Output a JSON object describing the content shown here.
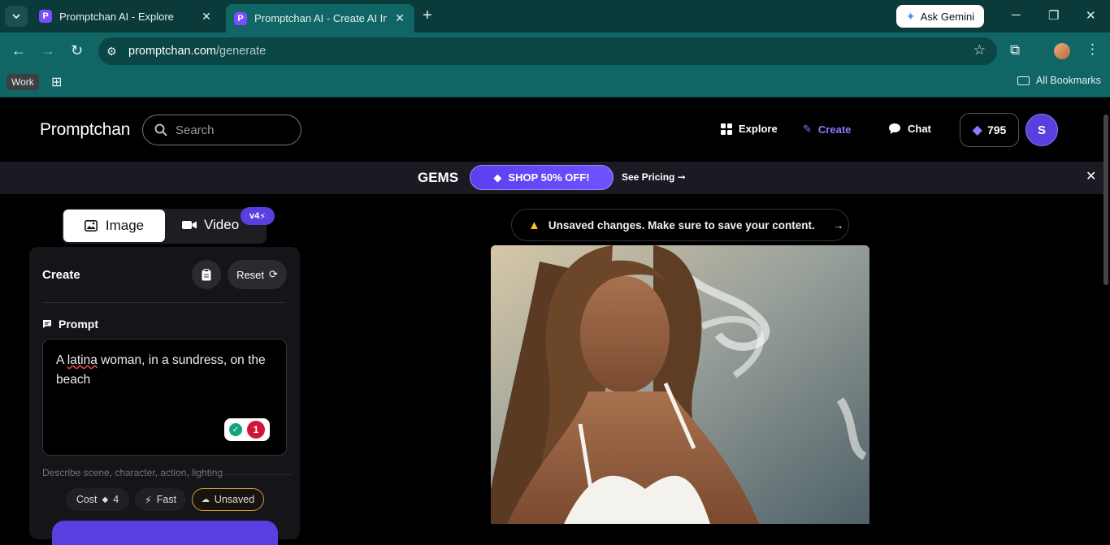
{
  "browser": {
    "tabs": [
      {
        "title": "Promptchan AI - Explore",
        "favicon": "P"
      },
      {
        "title": "Promptchan AI - Create AI Images",
        "favicon": "P"
      }
    ],
    "ask_gemini": "Ask Gemini",
    "url_host": "promptchan.com",
    "url_path": "/generate",
    "bookmarks": {
      "work": "Work",
      "all": "All Bookmarks"
    }
  },
  "header": {
    "logo": "Promptchan",
    "search_placeholder": "Search",
    "nav": {
      "explore": "Explore",
      "create": "Create",
      "chat": "Chat"
    },
    "gems": "795",
    "avatar_initial": "S"
  },
  "promo": {
    "title": "GEMS",
    "shop": "SHOP 50% OFF!",
    "pricing": "See Pricing ➞"
  },
  "mode": {
    "image": "Image",
    "video": "Video",
    "badge": "v4"
  },
  "panel": {
    "title": "Create",
    "reset": "Reset",
    "prompt_label": "Prompt",
    "prompt_before": "A ",
    "prompt_misspelled": "latina",
    "prompt_after": " woman, in a sundress, on the beach",
    "grammar_count": "1",
    "helper": "Describe scene, character, action, lighting",
    "chips": {
      "cost_label": "Cost",
      "cost_value": "4",
      "fast": "Fast",
      "unsaved": "Unsaved"
    }
  },
  "warning": {
    "text": "Unsaved changes. Make sure to save your content.",
    "arrow": "→"
  },
  "colors": {
    "accent": "#5a3fe0",
    "accent_light": "#8b7bff",
    "browser_chrome": "#106565",
    "warning": "#f5c518"
  }
}
